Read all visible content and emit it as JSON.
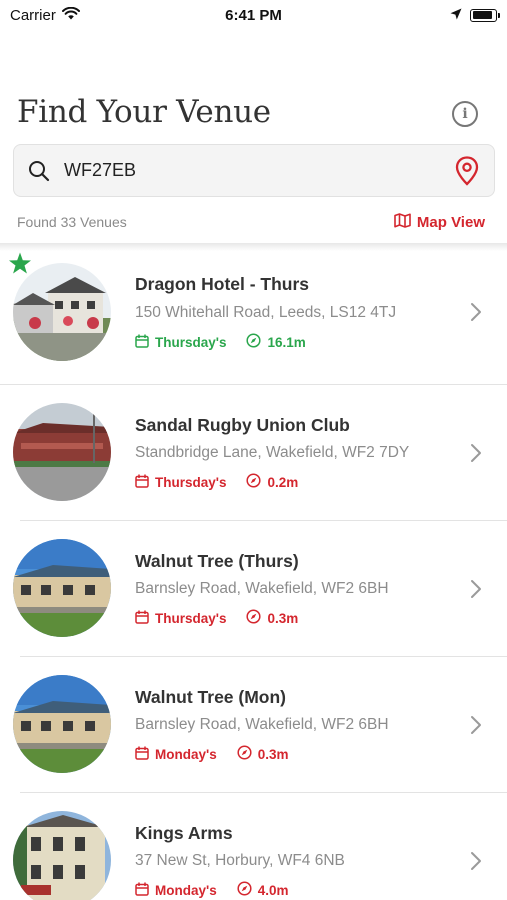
{
  "status_bar": {
    "carrier": "Carrier",
    "time": "6:41 PM",
    "battery_level": 0.9
  },
  "header": {
    "title": "Find Your Venue",
    "info_icon": "info-icon"
  },
  "search": {
    "value": "WF27EB",
    "placeholder": "",
    "icon": "search-icon",
    "location_icon": "location-pin-icon"
  },
  "results": {
    "count_text": "Found 33 Venues",
    "map_view_label": "Map View"
  },
  "colors": {
    "accent_red": "#d4262e",
    "accent_green": "#2aa64c",
    "text_dark": "#333333",
    "text_grey": "#8c8c8c"
  },
  "venues": [
    {
      "name": "Dragon Hotel - Thurs",
      "address": "150 Whitehall Road, Leeds, LS12 4TJ",
      "day": "Thursday's",
      "distance": "16.1m",
      "favorite": true,
      "status_color": "green"
    },
    {
      "name": "Sandal Rugby Union Club",
      "address": "Standbridge Lane, Wakefield, WF2 7DY",
      "day": "Thursday's",
      "distance": "0.2m",
      "favorite": false,
      "status_color": "red"
    },
    {
      "name": "Walnut Tree (Thurs)",
      "address": "Barnsley Road, Wakefield, WF2 6BH",
      "day": "Thursday's",
      "distance": "0.3m",
      "favorite": false,
      "status_color": "red"
    },
    {
      "name": "Walnut Tree (Mon)",
      "address": "Barnsley Road, Wakefield, WF2 6BH",
      "day": "Monday's",
      "distance": "0.3m",
      "favorite": false,
      "status_color": "red"
    },
    {
      "name": "Kings Arms",
      "address": "37 New St, Horbury, WF4 6NB",
      "day": "Monday's",
      "distance": "4.0m",
      "favorite": false,
      "status_color": "red"
    }
  ]
}
